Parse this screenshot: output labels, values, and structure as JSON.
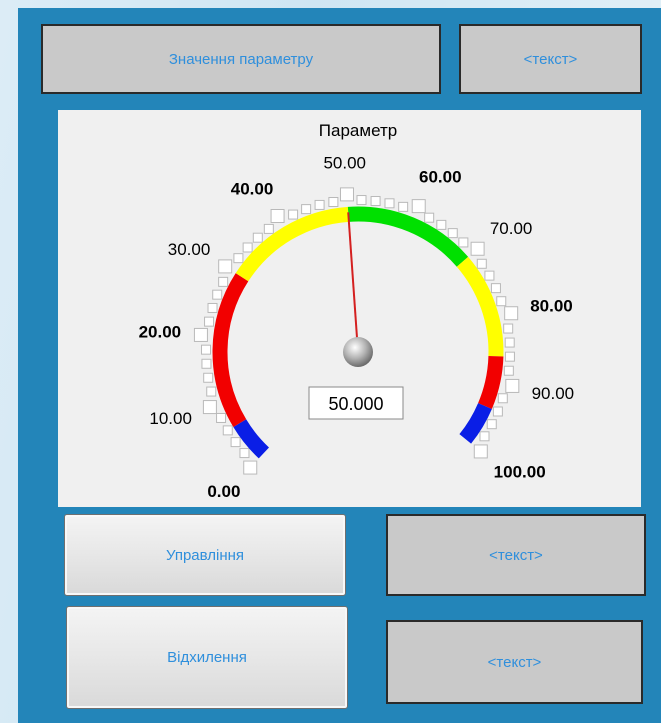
{
  "header": {
    "value_label": "Значення параметру",
    "value_text": "<текст>"
  },
  "gauge": {
    "title": "Параметр",
    "value": 50.0,
    "value_display": "50.000",
    "min": 0,
    "max": 100,
    "tick_labels": [
      "0.00",
      "10.00",
      "20.00",
      "30.00",
      "40.00",
      "50.00",
      "60.00",
      "70.00",
      "80.00",
      "90.00",
      "100.00"
    ],
    "bold_labels": [
      "0.00",
      "20.00",
      "40.00",
      "60.00",
      "80.00",
      "100.00"
    ],
    "bands": [
      {
        "from": 0,
        "to": 6,
        "color": "#0a1ee6"
      },
      {
        "from": 6,
        "to": 30,
        "color": "#f20000"
      },
      {
        "from": 30,
        "to": 50,
        "color": "#ffff00"
      },
      {
        "from": 50,
        "to": 70,
        "color": "#00e000"
      },
      {
        "from": 70,
        "to": 86,
        "color": "#ffff00"
      },
      {
        "from": 86,
        "to": 94,
        "color": "#f20000"
      },
      {
        "from": 94,
        "to": 100,
        "color": "#0a1ee6"
      }
    ],
    "needle_color": "#d42020"
  },
  "controls": {
    "control_label": "Управління",
    "control_text": "<текст>",
    "deviation_label": "Відхилення",
    "deviation_text": "<текст>"
  }
}
